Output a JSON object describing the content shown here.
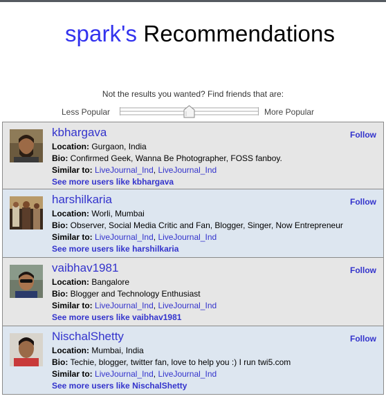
{
  "header": {
    "owner": "spark's",
    "title_rest": "Recommendations"
  },
  "filter": {
    "prompt": "Not the results you wanted? Find friends that are:",
    "less_label": "Less Popular",
    "more_label": "More Popular",
    "popularity_level": 0.5
  },
  "labels": {
    "location": "Location:",
    "bio": "Bio:",
    "similar": "Similar to:",
    "follow": "Follow",
    "separator": ", "
  },
  "users": [
    {
      "username": "kbhargava",
      "location": "Gurgaon, India",
      "bio": "Confirmed Geek, Wanna Be Photographer, FOSS fanboy.",
      "similar": [
        "LiveJournal_Ind",
        "LiveJournal_Ind"
      ],
      "see_more": "See more users like kbhargava"
    },
    {
      "username": "harshilkaria",
      "location": "Worli, Mumbai",
      "bio": "Observer, Social Media Critic and Fan, Blogger, Singer, Now Entrepreneur",
      "similar": [
        "LiveJournal_Ind",
        "LiveJournal_Ind"
      ],
      "see_more": "See more users like harshilkaria"
    },
    {
      "username": "vaibhav1981",
      "location": "Bangalore",
      "bio": "Blogger and Technology Enthusiast",
      "similar": [
        "LiveJournal_Ind",
        "LiveJournal_Ind"
      ],
      "see_more": "See more users like vaibhav1981"
    },
    {
      "username": "NischalShetty",
      "location": "Mumbai, India",
      "bio": "Techie, blogger, twitter fan, love to help you :) I run twi5.com",
      "similar": [
        "LiveJournal_Ind",
        "LiveJournal_Ind"
      ],
      "see_more": "See more users like NischalShetty"
    }
  ]
}
